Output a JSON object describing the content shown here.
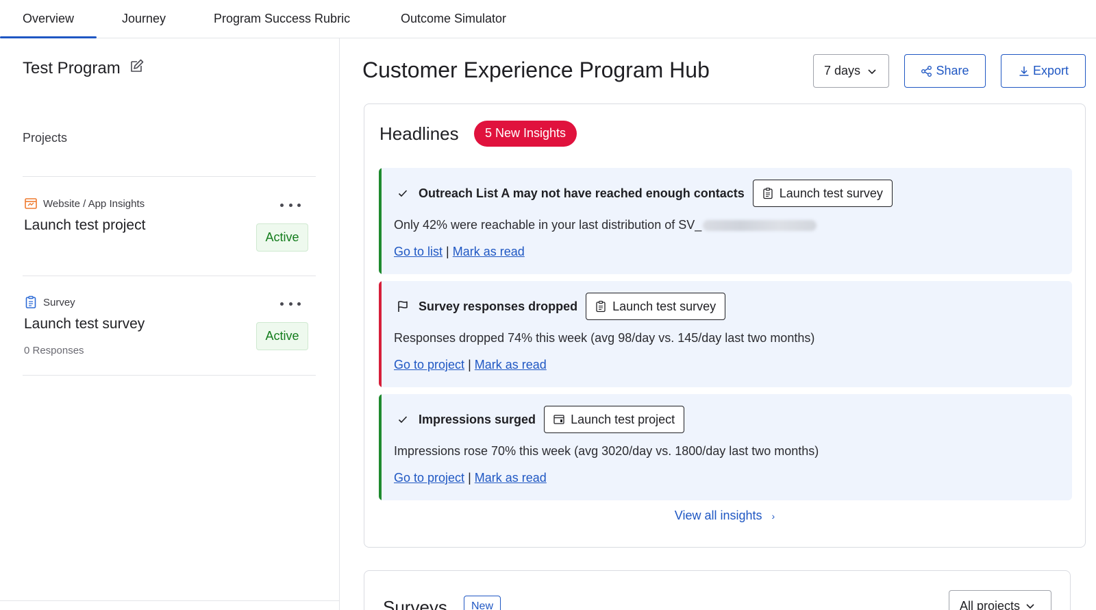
{
  "tabs": [
    {
      "label": "Overview",
      "active": true
    },
    {
      "label": "Journey",
      "active": false
    },
    {
      "label": "Program Success Rubric",
      "active": false
    },
    {
      "label": "Outcome Simulator",
      "active": false
    }
  ],
  "sidebar": {
    "program_title": "Test Program",
    "projects_label": "Projects",
    "projects": [
      {
        "type_label": "Website / App Insights",
        "type_icon": "website-insights-icon",
        "name": "Launch test project",
        "subtitle": "",
        "status": "Active"
      },
      {
        "type_label": "Survey",
        "type_icon": "survey-icon",
        "name": "Launch test survey",
        "subtitle": "0 Responses",
        "status": "Active"
      }
    ]
  },
  "header": {
    "title": "Customer Experience Program Hub",
    "range_select": "7 days",
    "share_label": "Share",
    "export_label": "Export"
  },
  "headlines": {
    "title": "Headlines",
    "badge": "5 New Insights",
    "insights": [
      {
        "icon": "check-icon",
        "title": "Outreach List A may not have reached enough contacts",
        "chip_label": "Launch test survey",
        "chip_icon": "survey-icon",
        "body": "Only 42% were reachable in your last distribution of SV_",
        "link1": "Go to list",
        "separator": "|",
        "link2": "Mark as read",
        "accent": "#1e8a2e"
      },
      {
        "icon": "flag-icon",
        "title": "Survey responses dropped",
        "chip_label": "Launch test survey",
        "chip_icon": "survey-icon",
        "body": "Responses dropped 74% this week (avg 98/day vs. 145/day last two months)",
        "link1": "Go to project",
        "separator": "|",
        "link2": "Mark as read",
        "accent": "#d61f3a"
      },
      {
        "icon": "check-icon",
        "title": "Impressions surged",
        "chip_label": "Launch test project",
        "chip_icon": "website-insights-icon",
        "body": "Impressions rose 70% this week (avg 3020/day vs. 1800/day last two months)",
        "link1": "Go to project",
        "separator": "|",
        "link2": "Mark as read",
        "accent": "#1e8a2e"
      }
    ],
    "view_all": "View all insights",
    "view_all_chevron": "›"
  },
  "surveys": {
    "title": "Surveys",
    "badge": "New",
    "filter": "All projects"
  },
  "colors": {
    "primary": "#1f57c3",
    "badge_red": "#e0123d",
    "success": "#137c1c"
  }
}
